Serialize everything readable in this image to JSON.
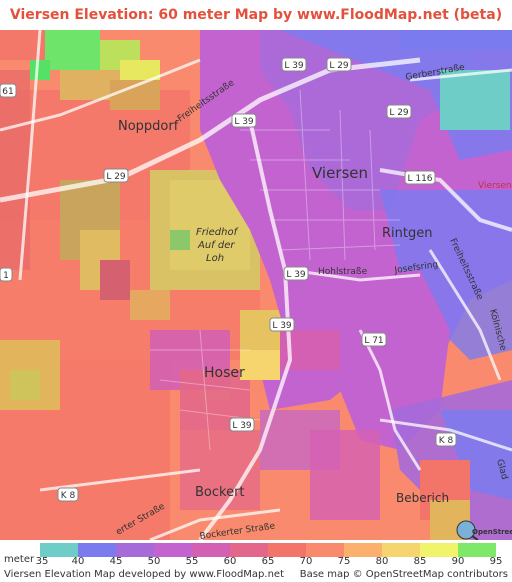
{
  "title": "Viersen Elevation: 60 meter Map by www.FloodMap.net (beta)",
  "map": {
    "places": [
      {
        "id": "viersen",
        "text": "Viersen"
      },
      {
        "id": "noppdorf",
        "text": "Noppdorf"
      },
      {
        "id": "rintgen",
        "text": "Rintgen"
      },
      {
        "id": "hoser",
        "text": "Hoser"
      },
      {
        "id": "bockert",
        "text": "Bockert"
      },
      {
        "id": "beberich",
        "text": "Beberich"
      },
      {
        "id": "friedhof1",
        "text": "Friedhof"
      },
      {
        "id": "friedhof2",
        "text": "Auf der"
      },
      {
        "id": "friedhof3",
        "text": "Loh"
      },
      {
        "id": "viersen-edge",
        "text": "Viersen"
      }
    ],
    "roads": [
      {
        "id": "l39a",
        "text": "L 39"
      },
      {
        "id": "l39b",
        "text": "L 39"
      },
      {
        "id": "l39c",
        "text": "L 39"
      },
      {
        "id": "l39d",
        "text": "L 39"
      },
      {
        "id": "l39e",
        "text": "L 39"
      },
      {
        "id": "l29a",
        "text": "L 29"
      },
      {
        "id": "l29b",
        "text": "L 29"
      },
      {
        "id": "l29c",
        "text": "L 29"
      },
      {
        "id": "l116",
        "text": "L 116"
      },
      {
        "id": "l71",
        "text": "L 71"
      },
      {
        "id": "k8a",
        "text": "K 8"
      },
      {
        "id": "k8b",
        "text": "K 8"
      },
      {
        "id": "l61",
        "text": "61"
      },
      {
        "id": "l1",
        "text": "1"
      }
    ],
    "streets": [
      {
        "id": "gerberstrasse",
        "text": "Gerberstraße"
      },
      {
        "id": "freiheitsstrasse",
        "text": "Freiheitsstraße"
      },
      {
        "id": "hohlstrasse",
        "text": "Hohlstraße"
      },
      {
        "id": "josefsring",
        "text": "Josefsring"
      },
      {
        "id": "freiheitsstrasse2",
        "text": "Freiheitsstraße"
      },
      {
        "id": "bockerter",
        "text": "Bockerter Straße"
      },
      {
        "id": "bockerter2",
        "text": "erter Straße"
      },
      {
        "id": "kolnische",
        "text": "Kölnische"
      },
      {
        "id": "gladbach",
        "text": "Glad"
      }
    ],
    "watermark": "OpenStreetMap"
  },
  "legend": {
    "unit": "meter",
    "items": [
      {
        "value": "35",
        "color": "#6ecdc6"
      },
      {
        "value": "40",
        "color": "#7b7bf0"
      },
      {
        "value": "45",
        "color": "#a66ad9"
      },
      {
        "value": "50",
        "color": "#c263d0"
      },
      {
        "value": "55",
        "color": "#d460b3"
      },
      {
        "value": "60",
        "color": "#e2678a"
      },
      {
        "value": "65",
        "color": "#f37469"
      },
      {
        "value": "70",
        "color": "#f98a6d"
      },
      {
        "value": "75",
        "color": "#fbb06e"
      },
      {
        "value": "80",
        "color": "#f6d56e"
      },
      {
        "value": "85",
        "color": "#f1f46a"
      },
      {
        "value": "90",
        "color": "#7ee868"
      },
      {
        "value": "95",
        "color": "#55e066"
      }
    ]
  },
  "footer": {
    "left": "Viersen Elevation Map developed by www.FloodMap.net",
    "right": "Base map © OpenStreetMap contributors"
  }
}
